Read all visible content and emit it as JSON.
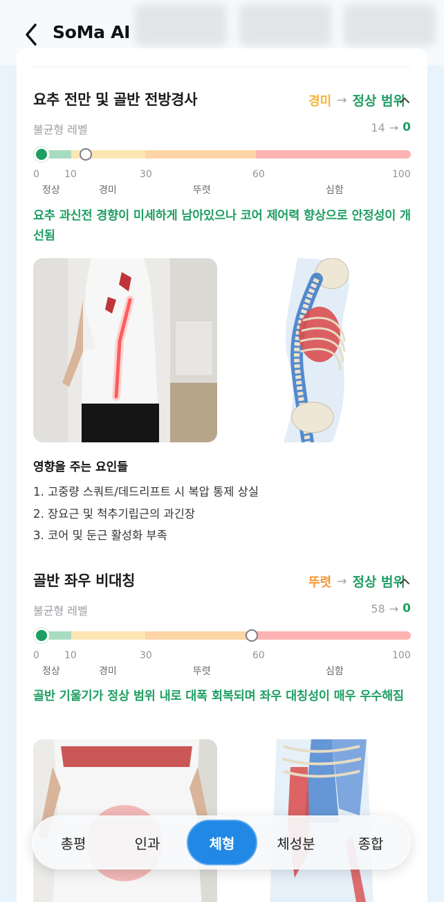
{
  "app": {
    "title": "SoMa AI"
  },
  "sections": [
    {
      "title": "요추 전만 및 골반 전방경사",
      "status_from": "경미",
      "status_arrow": "→",
      "status_to": "정상 범위",
      "level_label": "불균형 레벨",
      "level_from": "14",
      "level_to": "0",
      "level_current": 0,
      "level_previous": 14,
      "ticks": [
        "0",
        "10",
        "30",
        "60",
        "100"
      ],
      "grades": [
        "정상",
        "경미",
        "뚜렷",
        "심함"
      ],
      "description": "요추 과신전 경향이 미세하게 남아있으나 코어 제어력 향상으로 안정성이 개선됨",
      "factors_title": "영향을 주는 요인들",
      "factors": [
        "1. 고중량 스쿼트/데드리프트 시 복압 통제 상실",
        "2. 장요근 및 척추기립근의 과긴장",
        "3. 코어 및 둔근 활성화 부족"
      ]
    },
    {
      "title": "골반 좌우 비대칭",
      "status_from": "뚜렷",
      "status_arrow": "→",
      "status_to": "정상 범위",
      "level_label": "불균형 레벨",
      "level_from": "58",
      "level_to": "0",
      "level_current": 0,
      "level_previous": 58,
      "ticks": [
        "0",
        "10",
        "30",
        "60",
        "100"
      ],
      "grades": [
        "정상",
        "경미",
        "뚜렷",
        "심함"
      ],
      "description": "골반 기울기가 정상 범위 내로 대폭 회복되며 좌우 대칭성이 매우 우수해짐"
    }
  ],
  "bottom_nav": {
    "items": [
      "총평",
      "인과",
      "체형",
      "체성분",
      "종합"
    ],
    "active": "체형"
  },
  "colors": {
    "accent_green": "#1e9e62",
    "mild": "#f5b532",
    "marked": "#f3952e",
    "nav_active": "#2288e6"
  },
  "icons": [
    "back-arrow-icon",
    "chevron-up-icon"
  ]
}
